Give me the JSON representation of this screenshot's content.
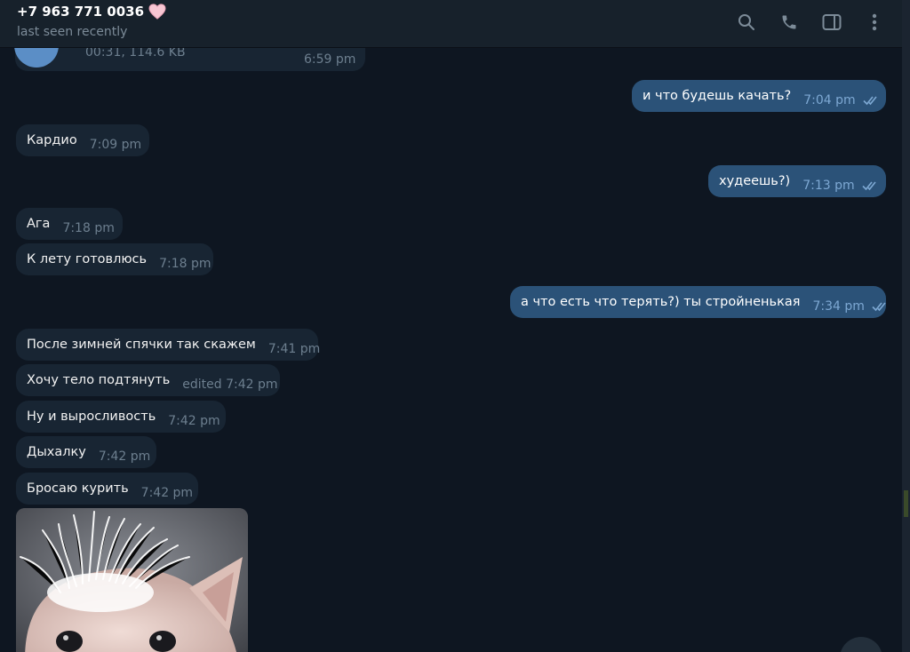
{
  "header": {
    "contact_name": "+7 963 771 0036",
    "status": "last seen recently",
    "icons": [
      "search-icon",
      "phone-icon",
      "sidebar-toggle-icon",
      "more-vertical-icon"
    ]
  },
  "audio": {
    "meta": "00:31, 114.6 KB",
    "time": "6:59 pm"
  },
  "messages": [
    {
      "dir": "out",
      "text": "и что будешь качать?",
      "time": "7:04 pm"
    },
    {
      "dir": "in",
      "text": "Кардио",
      "time": "7:09 pm"
    },
    {
      "dir": "out",
      "text": "худеешь?)",
      "time": "7:13 pm"
    },
    {
      "dir": "in",
      "text": "Ага",
      "time": "7:18 pm"
    },
    {
      "dir": "in",
      "text": "К лету готовлюсь",
      "time": "7:18 pm"
    },
    {
      "dir": "out",
      "text": "а что есть что терять?) ты стройненькая",
      "time": "7:34 pm"
    },
    {
      "dir": "in",
      "text": "После зимней спячки так скажем",
      "time": "7:41 pm"
    },
    {
      "dir": "in",
      "text": "Хочу тело подтянуть",
      "time": "edited 7:42 pm"
    },
    {
      "dir": "in",
      "text": "Ну и выросливость",
      "time": "7:42 pm"
    },
    {
      "dir": "in",
      "text": "Дыхалку",
      "time": "7:42 pm"
    },
    {
      "dir": "in",
      "text": "Бросаю курить",
      "time": "7:42 pm"
    }
  ],
  "colors": {
    "background": "#0e1621",
    "incoming": "#182533",
    "outgoing": "#2b5278",
    "header": "#17212b"
  }
}
